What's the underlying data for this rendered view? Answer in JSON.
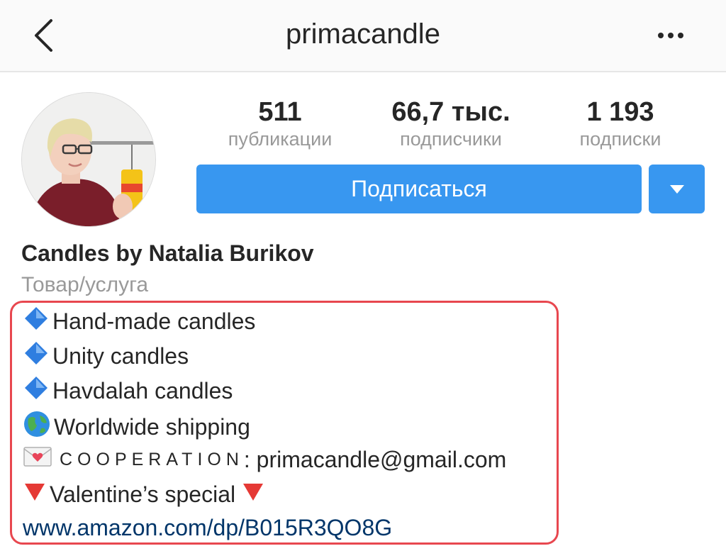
{
  "header": {
    "title": "primacandle"
  },
  "stats": {
    "posts": {
      "value": "511",
      "label": "публикации"
    },
    "followers": {
      "value": "66,7 тыс.",
      "label": "подписчики"
    },
    "following": {
      "value": "1 193",
      "label": "подписки"
    }
  },
  "actions": {
    "follow_label": "Подписаться"
  },
  "profile": {
    "name": "Candles by Natalia Burikov",
    "category": "Товар/услуга",
    "bio": {
      "line1": "Hand-made candles",
      "line2": "Unity candles",
      "line3": "Havdalah candles",
      "line4": "Worldwide shipping",
      "line5_label": "COOPERATION",
      "line5_email": ": primacandle@gmail.com",
      "line6": "Valentine’s special",
      "link": "www.amazon.com/dp/B015R3QO8G"
    }
  },
  "colors": {
    "accent": "#3897f0",
    "highlight_border": "#e8474f",
    "link": "#003569"
  }
}
